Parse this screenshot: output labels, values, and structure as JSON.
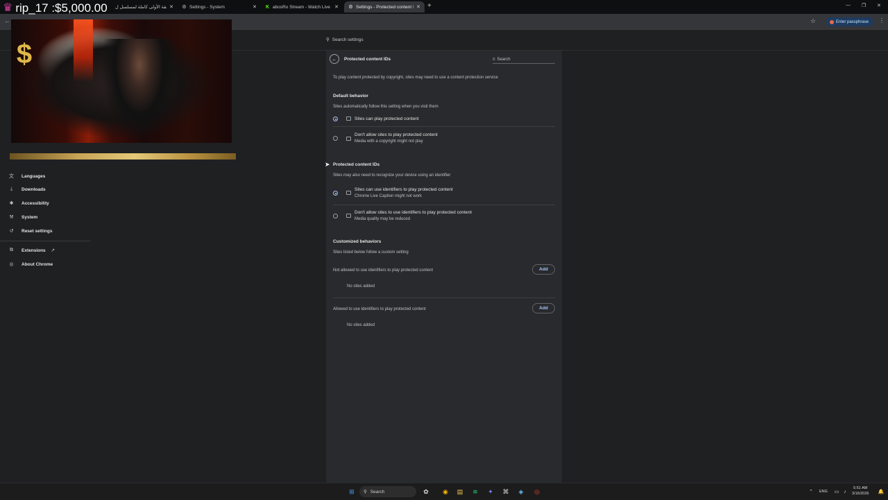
{
  "tabs": [
    {
      "title": "الحلقة الأولى كاملة لمسلسل ل",
      "active": false,
      "favicon": "page-icon"
    },
    {
      "title": "Settings - System",
      "active": false,
      "favicon": "gear-icon"
    },
    {
      "title": "abosRo Stream - Watch Live o",
      "active": false,
      "favicon": "kick-icon"
    },
    {
      "title": "Settings - Protected content ID",
      "active": true,
      "favicon": "gear-icon"
    }
  ],
  "toolbar": {
    "passphrase_label": "Enter passphrase"
  },
  "settings_search": {
    "placeholder": "Search settings"
  },
  "overlay": {
    "donation": "rip_17 :$5,000.00",
    "badge": "$"
  },
  "nav": [
    {
      "label": "Languages",
      "icon": "translate-icon"
    },
    {
      "label": "Downloads",
      "icon": "download-icon"
    },
    {
      "label": "Accessibility",
      "icon": "accessibility-icon"
    },
    {
      "label": "System",
      "icon": "wrench-icon"
    },
    {
      "label": "Reset settings",
      "icon": "reset-icon"
    },
    {
      "label": "Extensions",
      "icon": "puzzle-icon"
    },
    {
      "label": "About Chrome",
      "icon": "chrome-icon"
    }
  ],
  "page": {
    "title": "Protected content IDs",
    "search_placeholder": "Search",
    "intro": "To play content protected by copyright, sites may need to use a content protection service",
    "default_behavior": {
      "heading": "Default behavior",
      "sub": "Sites automatically follow this setting when you visit them",
      "options": [
        {
          "label": "Sites can play protected content",
          "desc": "",
          "selected": true
        },
        {
          "label": "Don't allow sites to play protected content",
          "desc": "Media with a copyright might not play",
          "selected": false
        }
      ]
    },
    "ids": {
      "heading": "Protected content IDs",
      "sub": "Sites may also need to recognize your device using an identifier",
      "options": [
        {
          "label": "Sites can use identifiers to play protected content",
          "desc": "Chrome Live Caption might not work",
          "selected": true
        },
        {
          "label": "Don't allow sites to use identifiers to play protected content",
          "desc": "Media quality may be reduced",
          "selected": false
        }
      ]
    },
    "custom": {
      "heading": "Customized behaviors",
      "sub": "Sites listed below follow a custom setting",
      "not_allowed_label": "Not allowed to use identifiers to play protected content",
      "allowed_label": "Allowed to use identifiers to play protected content",
      "add_label": "Add",
      "empty_label": "No sites added"
    }
  },
  "taskbar": {
    "search_label": "Search",
    "lang": "ENG",
    "time": "5:51 AM",
    "date": "3/16/2026"
  }
}
